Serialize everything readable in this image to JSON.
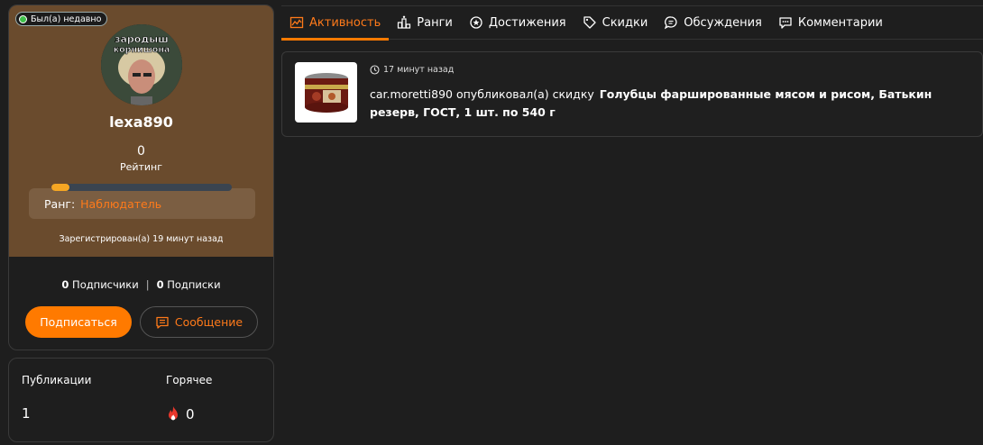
{
  "profile": {
    "status": "Был(а) недавно",
    "avatar_caption_1": "зародыш",
    "avatar_caption_2": "корнишона",
    "username": "lexa890",
    "rating_value": "0",
    "rating_label": "Рейтинг",
    "rank_progress": 0.1,
    "rank_label": "Ранг:",
    "rank_value": "Наблюдатель",
    "registered": "Зарегистрирован(а) 19 минут назад",
    "followers_count": "0",
    "followers_label": "Подписчики",
    "following_count": "0",
    "following_label": "Подписки",
    "subscribe_button": "Подписаться",
    "message_button": "Сообщение"
  },
  "stats": {
    "publications_label": "Публикации",
    "publications_value": "1",
    "hot_label": "Горячее",
    "hot_value": "0"
  },
  "tabs": [
    {
      "label": "Активность",
      "icon": "activity-icon",
      "active": true
    },
    {
      "label": "Ранги",
      "icon": "ranks-icon"
    },
    {
      "label": "Достижения",
      "icon": "achievements-icon"
    },
    {
      "label": "Скидки",
      "icon": "tag-icon"
    },
    {
      "label": "Обсуждения",
      "icon": "discussions-icon"
    },
    {
      "label": "Комментарии",
      "icon": "comments-icon"
    }
  ],
  "activity": {
    "time": "17 минут назад",
    "actor_text": "car.moretti890 опубликовал(а) скидку",
    "product": "Голубцы фаршированные мясом и рисом, Батькин резерв, ГОСТ, 1 шт. по 540 г"
  },
  "colors": {
    "accent": "#ff7a00",
    "profile_bg": "#6a4b2d",
    "page_bg": "#1e1e1e",
    "online": "#3fbf4a"
  }
}
